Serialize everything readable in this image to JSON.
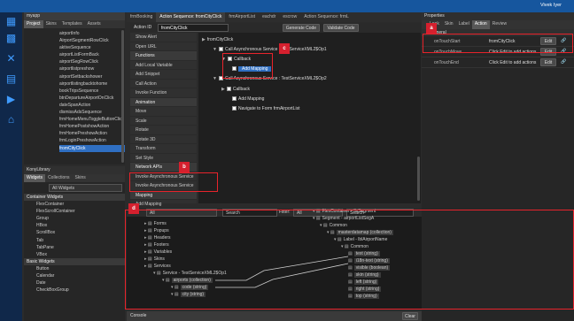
{
  "topbar": {
    "user": "Vivek Iyer"
  },
  "project": {
    "name": "myapp",
    "tabs": [
      "Project",
      "Skins",
      "Templates",
      "Assets"
    ],
    "items": [
      "airportInfo",
      "AirportSegmentRowClick",
      "aktiveSequence",
      "airportListFormBack",
      "airportSegRowClick",
      "airportlistpreshow",
      "airportSetbackshower",
      "airportlistingbacktohome",
      "bookTripsSequence",
      "btnDepartureAirportOnClick",
      "dateSpanAction",
      "dismissAdsSequence",
      "frmHomeMenuToggleButtonClick",
      "frmHomePostshowAction",
      "frmHomePreshowAction",
      "frmLoginPreshowAction",
      "fromCityClick"
    ]
  },
  "library": {
    "title": "KonyLibrary",
    "tabs": [
      "Widgets",
      "Collections",
      "Skins"
    ],
    "filter": "All Widgets",
    "container_header": "Container Widgets",
    "containers": [
      "FlexContainer",
      "FlexScrollContainer",
      "Group",
      "HBox",
      "ScrollBox",
      "Tab",
      "TabPane",
      "VBox"
    ],
    "basic_header": "Basic Widgets",
    "basics": [
      "Button",
      "Calendar",
      "Date",
      "CheckBoxGroup"
    ]
  },
  "doctabs": [
    "frmBooking",
    "Action Sequence: fromCityClick",
    "frmAirportList",
    "eachdr",
    "escrow",
    "Action Sequence: frmL"
  ],
  "action": {
    "id_label": "Action ID",
    "id_value": "fromCityClick",
    "generate": "Generate Code",
    "validate": "Validate Code"
  },
  "actions": [
    "Show Alert",
    "Open URL",
    "Functions",
    "Add Local Variable",
    "Add Snippet",
    "Call Action",
    "Invoke Function",
    "Animation",
    "Move",
    "Scale",
    "Rotate",
    "Rotate 3D",
    "Transform",
    "Set Style",
    "Network APIs",
    "Invoke Asynchronous Service",
    "Invoke Asynchronous Service",
    "Mapping",
    "Add Mapping"
  ],
  "editor": {
    "root": "fromCityClick",
    "call1": "Call Asynchronous Service : TestServiceXML2$Op1",
    "callback": "Callback",
    "addmap": "Add Mapping",
    "call2": "Call Asynchronous Service : TestServiceXML2$Op2",
    "callback2": "Callback",
    "addmap2": "Add Mapping",
    "navigate": "Navigate to Form frmAirportList"
  },
  "badges": {
    "a": "a",
    "b": "b",
    "c": "c",
    "d": "d"
  },
  "props": {
    "title": "Properties",
    "tabs": [
      "Look",
      "Skin",
      "Label",
      "Action",
      "Review"
    ],
    "section": "General",
    "rows": [
      {
        "name": "onTouchStart",
        "value": "fromCityClick",
        "btn": "Edit"
      },
      {
        "name": "onTouchMove",
        "value": "Click Edit to add actions",
        "btn": "Edit"
      },
      {
        "name": "onTouchEnd",
        "value": "Click Edit to add actions",
        "btn": "Edit"
      }
    ]
  },
  "mapping": {
    "left_filter": "All",
    "search1": "Search",
    "right_label": "Filter:",
    "right_filter": "All",
    "search2": "Search",
    "left": [
      "Forms",
      "Popups",
      "Headers",
      "Footers",
      "Variables",
      "Skins",
      "Services",
      "Service - TestServiceXML2$Op1",
      "airports (collection)",
      "code (string)",
      "city (string)"
    ],
    "right": [
      "FlexContainer - flxSegment",
      "Segment - airportListSegA",
      "Common",
      "masterdatamap (collection)",
      "Label - lblAirportName",
      "Common",
      "text (string)",
      "i18n-text (string)",
      "visible (boolean)",
      "skin (string)",
      "left (string)",
      "right (string)",
      "top (string)"
    ]
  },
  "console": {
    "label": "Console",
    "clear": "Clear"
  }
}
